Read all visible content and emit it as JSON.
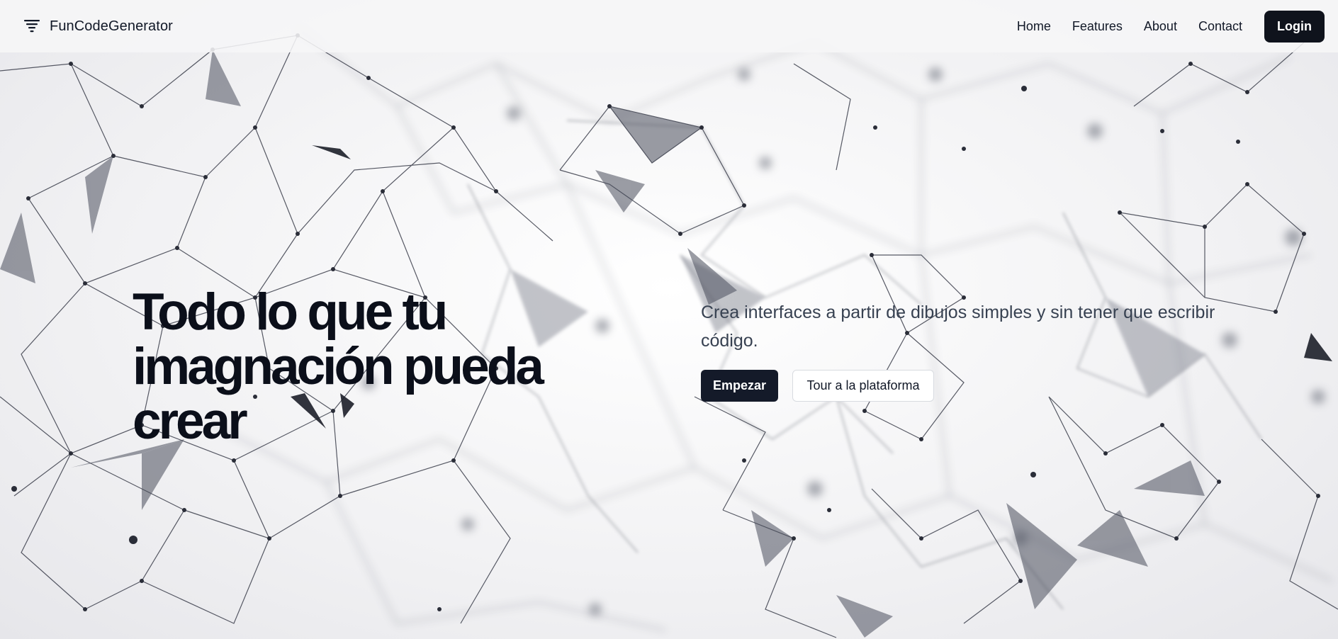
{
  "header": {
    "brand_name": "FunCodeGenerator",
    "brand_icon": "filter-icon",
    "nav": [
      {
        "label": "Home"
      },
      {
        "label": "Features"
      },
      {
        "label": "About"
      },
      {
        "label": "Contact"
      }
    ],
    "login_label": "Login"
  },
  "hero": {
    "title": "Todo lo que tu imagnación pueda crear",
    "subtitle": "Crea interfaces a partir de dibujos simples y sin tener que escribir código.",
    "primary_label": "Empezar",
    "secondary_label": "Tour a la plataforma"
  },
  "colors": {
    "accent_dark": "#0f131c",
    "text_primary": "#0b0f1a",
    "text_secondary": "#374151",
    "network_line": "#3a3d4a"
  }
}
